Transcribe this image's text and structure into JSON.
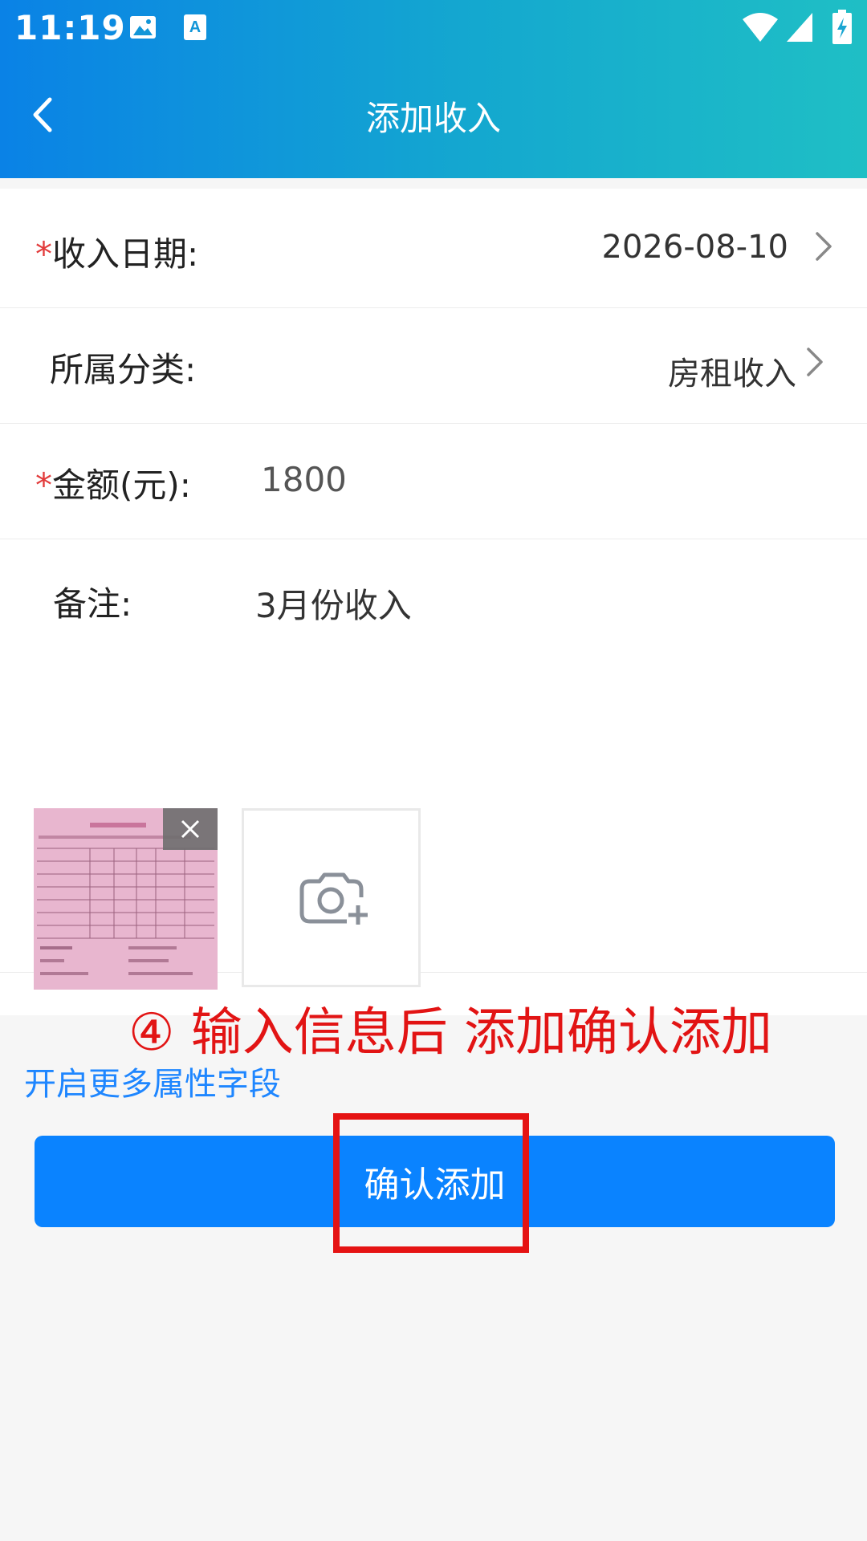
{
  "status_bar": {
    "time": "11:19"
  },
  "header": {
    "title": "添加收入"
  },
  "form": {
    "date_label": "收入日期:",
    "date_value": "2026-08-10",
    "category_label": "所属分类:",
    "category_value": "房租收入",
    "amount_label": "金额(元):",
    "amount_value": "1800",
    "note_label": "备注:",
    "note_value": "3月份收入",
    "required_mark": "*"
  },
  "annotation": "④ 输入信息后 添加确认添加",
  "more_fields_link": "开启更多属性字段",
  "confirm_button": "确认添加",
  "colors": {
    "accent": "#0a83ff",
    "header_start": "#0a82e6",
    "header_end": "#1fbfc5",
    "required": "#e23b3b",
    "annotation": "#e21414"
  }
}
